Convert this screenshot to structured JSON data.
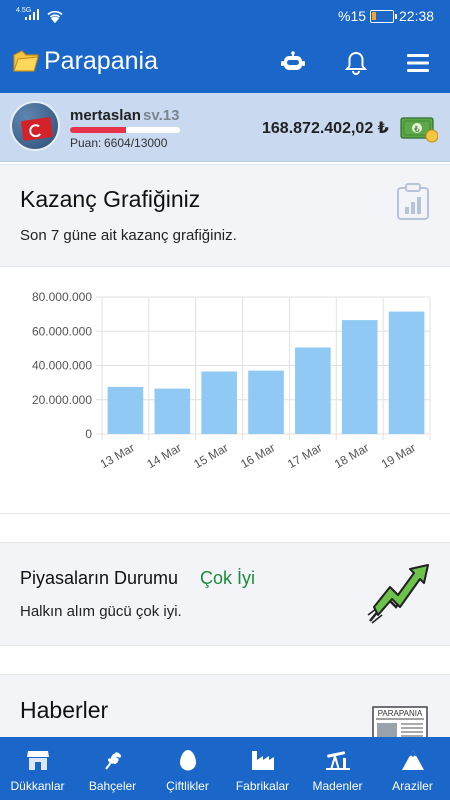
{
  "status_bar": {
    "network": "4.5G",
    "battery_percent": "%15",
    "time": "22:38"
  },
  "app_bar": {
    "title": "Parapania",
    "icons": [
      "folder-logo-icon",
      "robot-icon",
      "bell-icon",
      "menu-icon"
    ]
  },
  "profile": {
    "username": "mertaslan",
    "level": "sv.13",
    "points_label": "Puan:",
    "points_value": "6604/13000",
    "xp_progress": 0.508,
    "balance": "168.872.402,02 ₺"
  },
  "earnings": {
    "title": "Kazanç Grafiğiniz",
    "subtitle": "Son 7 güne ait kazanç grafiğiniz."
  },
  "chart_data": {
    "type": "bar",
    "categories": [
      "13 Mar",
      "14 Mar",
      "15 Mar",
      "16 Mar",
      "17 Mar",
      "18 Mar",
      "19 Mar"
    ],
    "values": [
      27500000,
      26500000,
      36500000,
      37000000,
      50500000,
      66500000,
      71500000
    ],
    "y_ticks": [
      "80.000.000",
      "60.000.000",
      "40.000.000",
      "20.000.000",
      "0"
    ],
    "ylim": [
      0,
      80000000
    ],
    "grid": true,
    "bar_color": "#90caf4"
  },
  "market": {
    "title": "Piyasaların Durumu",
    "status": "Çok İyi",
    "status_color": "#1c8a3a",
    "subtitle": "Halkın alım gücü çok iyi."
  },
  "news": {
    "title": "Haberler",
    "newspaper_label": "PARAPANIA"
  },
  "bottom_nav": [
    {
      "label": "Dükkanlar",
      "icon": "store-icon"
    },
    {
      "label": "Bahçeler",
      "icon": "wheat-icon"
    },
    {
      "label": "Çiftlikler",
      "icon": "egg-icon"
    },
    {
      "label": "Fabrikalar",
      "icon": "factory-icon"
    },
    {
      "label": "Madenler",
      "icon": "pumpjack-icon"
    },
    {
      "label": "Araziler",
      "icon": "mountain-icon"
    }
  ],
  "colors": {
    "primary": "#1a66c9",
    "profile_bg": "#c9daf0",
    "section_bg": "#f2f4f8"
  }
}
